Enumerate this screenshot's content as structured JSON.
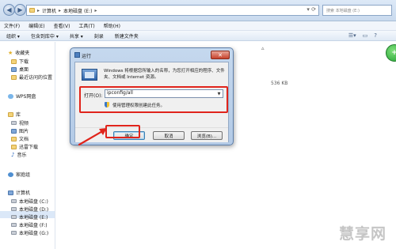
{
  "address_bar": {
    "crumbs": [
      "计算机",
      "本地磁盘 (E:)"
    ],
    "search_placeholder": "搜索 本地磁盘 (E:)"
  },
  "menu": [
    "文件(F)",
    "编辑(E)",
    "查看(V)",
    "工具(T)",
    "帮助(H)"
  ],
  "toolbar": {
    "items": [
      "组织 ▾",
      "包含到库中 ▾",
      "共享 ▾",
      "刻录",
      "新建文件夹"
    ]
  },
  "sidebar": {
    "favorites": "收藏夹",
    "fav_items": [
      "下载",
      "桌面",
      "最近访问的位置"
    ],
    "wps": "WPS网盘",
    "library": "库",
    "library_items": [
      "视频",
      "图片",
      "文档",
      "迅雷下载",
      "音乐"
    ],
    "homegroup": "家庭组",
    "computer": "计算机",
    "drives": [
      "本地磁盘 (C:)",
      "本地磁盘 (D:)",
      "本地磁盘 (E:)",
      "本地磁盘 (F:)",
      "本地磁盘 (G:)"
    ]
  },
  "main": {
    "file_size": "536 KB"
  },
  "dialog": {
    "title": "运行",
    "description": "Windows 将根据您所输入的名称，为您打开相应的程序、文件夹、文档或 Internet 资源。",
    "open_label": "打开(O):",
    "command": "ipconfig/all",
    "admin_note": "使用管理权限创建此任务。",
    "ok": "确定",
    "cancel": "取消",
    "browse": "浏览(B)..."
  },
  "watermark": "慧享网",
  "colors": {
    "highlight": "#e0241b",
    "accent": "#2f64a8"
  }
}
